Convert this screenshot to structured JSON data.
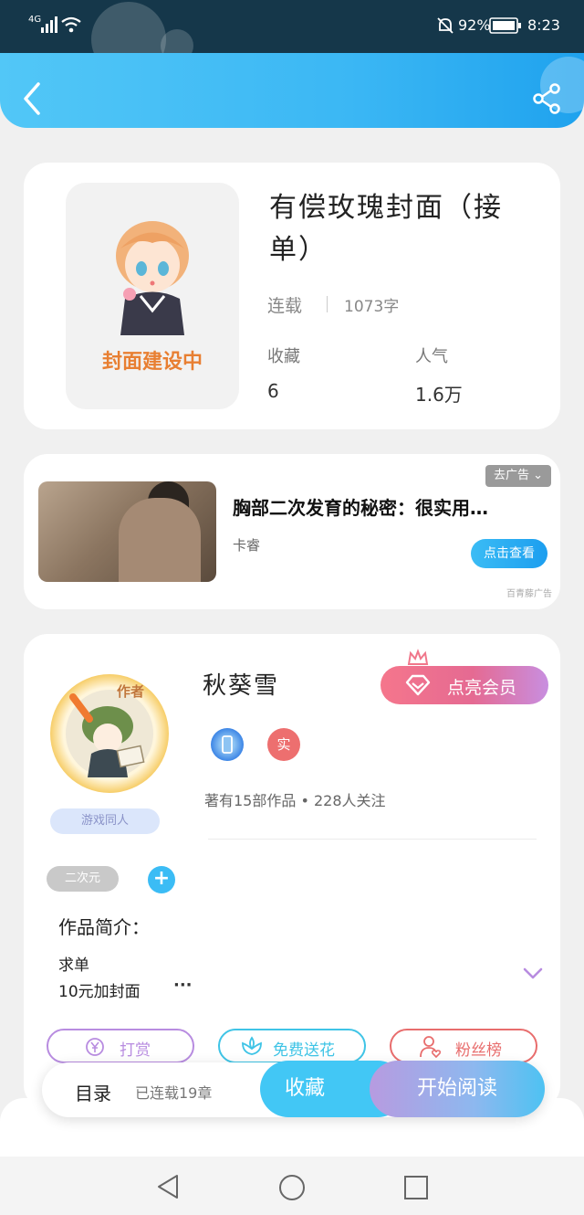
{
  "status_bar": {
    "network": "4G",
    "battery": "92%",
    "time": "8:23"
  },
  "header": {
    "back_icon": "chevron-left-icon",
    "share_icon": "share-icon"
  },
  "book": {
    "cover_text": "封面建设中",
    "title_line1": "有偿玫瑰封面（接",
    "title_line2": "单）",
    "status": "连载",
    "word_count": "1073字",
    "favorites_label": "收藏",
    "favorites_value": "6",
    "popularity_label": "人气",
    "popularity_value": "1.6万"
  },
  "ad": {
    "close_label": "去广告",
    "title": "胸部二次发育的秘密：很实用…",
    "source": "卡睿",
    "button": "点击查看",
    "brand": "百青藤广告"
  },
  "author": {
    "badge": "作者",
    "tag": "游戏同人",
    "name": "秋葵雪",
    "vip_button": "点亮会员",
    "real_badge": "实",
    "works": "著有15部作品 • 228人关注",
    "category_chip": "二次元",
    "intro_label": "作品简介：",
    "intro_line1": "求单",
    "intro_line2": "10元加封面",
    "intro_more": "···",
    "reward_button": "打赏",
    "flower_button": "免费送花",
    "fans_button": "粉丝榜"
  },
  "bottom_bar": {
    "catalog_label": "目录",
    "chapters": "已连载19章",
    "favorite_button": "收藏",
    "read_button": "开始阅读"
  },
  "colors": {
    "accent": "#3bbcf5",
    "vip_pink": "#f5768c",
    "reward_purple": "#b88ce0",
    "flower_cyan": "#3fc4e6",
    "fans_red": "#e86d6d"
  }
}
